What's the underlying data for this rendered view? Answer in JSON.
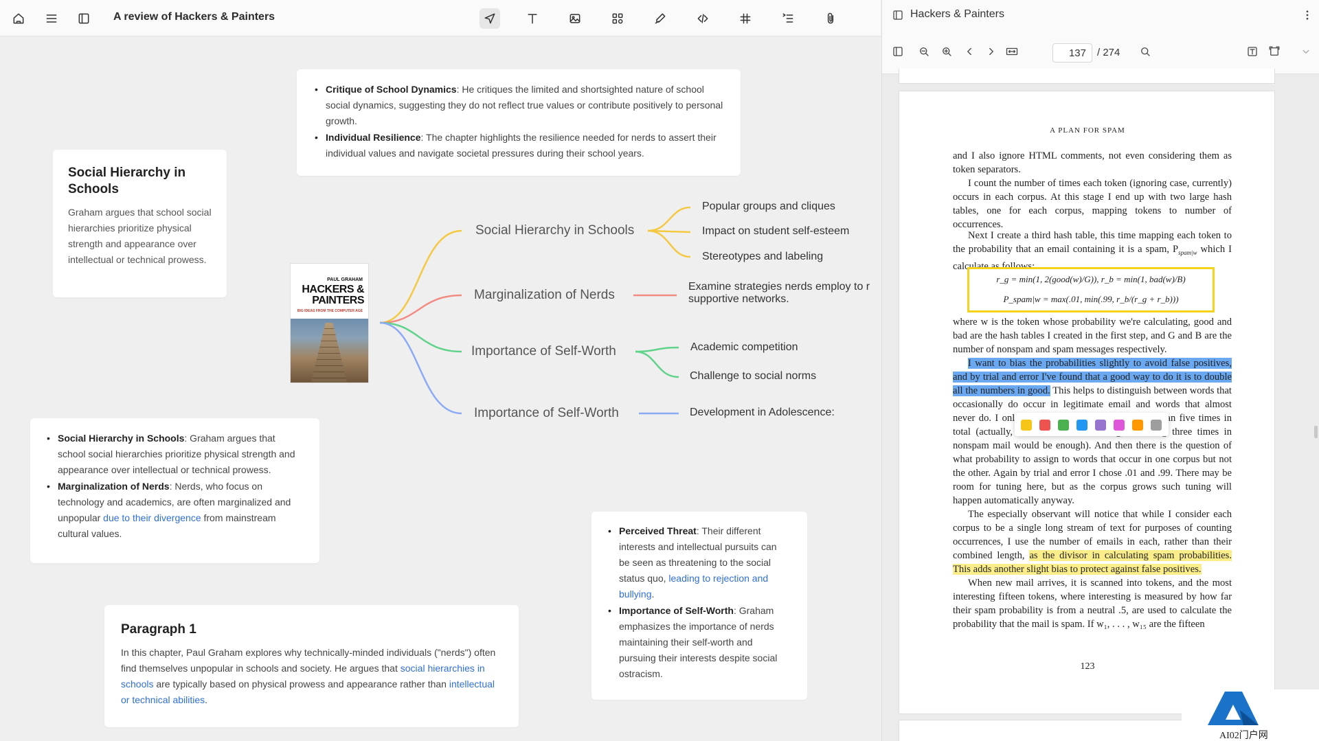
{
  "left": {
    "doc_title": "A review of Hackers & Painters",
    "toolbar_icons": [
      "home-icon",
      "menu-icon",
      "sidebar-icon",
      "navigate-icon",
      "text-icon",
      "image-icon",
      "shapes-icon",
      "pen-icon",
      "code-icon",
      "hash-icon",
      "outline-icon",
      "attach-icon"
    ],
    "top_card": {
      "items": [
        {
          "bold": "Critique of School Dynamics",
          "text": ": He critiques the limited and shortsighted nature of school social dynamics, suggesting they do not reflect true values or contribute positively to personal growth."
        },
        {
          "bold": "Individual Resilience",
          "text": ": The chapter highlights the resilience needed for nerds to assert their individual values and navigate societal pressures during their school years."
        }
      ]
    },
    "social_card": {
      "title": "Social Hierarchy in Schools",
      "body": "Graham argues that school social hierarchies prioritize physical strength and appearance over intellectual or technical prowess."
    },
    "book_cover": {
      "author": "PAUL GRAHAM",
      "title_line1": "HACKERS &",
      "title_line2": "PAINTERS",
      "subtitle": "BIG IDEAS FROM THE COMPUTER AGE"
    },
    "mindmap": {
      "branches": [
        {
          "label": "Social Hierarchy in Schools",
          "color": "#f5c842",
          "leaves": [
            "Popular groups and cliques",
            "Impact on student self-esteem",
            "Stereotypes and labeling"
          ]
        },
        {
          "label": "Marginalization of Nerds",
          "color": "#f28b82",
          "leaves": [
            "Examine strategies nerds employ to r",
            "supportive networks."
          ]
        },
        {
          "label": "Importance of Self-Worth",
          "color": "#5fd38a",
          "leaves": [
            "Academic competition",
            "Challenge to social norms"
          ]
        },
        {
          "label": "Importance of Self-Worth",
          "color": "#8aaaf5",
          "leaves": [
            "Development in Adolescence:"
          ]
        }
      ]
    },
    "bottom_left_card": {
      "items": [
        {
          "bold": "Social Hierarchy in Schools",
          "text": ": Graham argues that school social hierarchies prioritize physical strength and appearance over intellectual or technical prowess."
        },
        {
          "bold": "Marginalization of Nerds",
          "text": ": Nerds, who focus on technology and academics, are often marginalized and unpopular ",
          "link": "due to their divergence",
          "tail": " from mainstream cultural values."
        }
      ]
    },
    "paragraph_card": {
      "title": "Paragraph 1",
      "text1": "In this chapter, Paul Graham explores why technically-minded individuals (\"nerds\") often find themselves unpopular in schools and society. He argues that ",
      "link1": "social hierarchies in schools",
      "text2": " are typically based on physical prowess and appearance rather than ",
      "link2": "intellectual or technical abilities",
      "text3": "."
    },
    "right_card": {
      "items": [
        {
          "bold": "Perceived Threat",
          "text": ": Their different interests and intellectual pursuits can be seen as threatening to the social status quo, ",
          "link": "leading to rejection and bullying",
          "tail": "."
        },
        {
          "bold": "Importance of Self-Worth",
          "text": ": Graham emphasizes the importance of nerds maintaining their self-worth and pursuing their interests despite social ostracism."
        }
      ]
    }
  },
  "right": {
    "title": "Hackers & Painters",
    "current_page": "137",
    "total_pages": "/ 274",
    "pdf": {
      "running_head": "A PLAN FOR SPAM",
      "p1": "and I also ignore HTML comments, not even considering them as token separators.",
      "p2": "I count the number of times each token (ignoring case, currently) occurs in each corpus. At this stage I end up with two large hash tables, one for each corpus, mapping tokens to number of occurrences.",
      "p3": "Next I create a third hash table, this time mapping each token to the probability that an email containing it is a spam, P",
      "p3_sub": "spam|w",
      "p3_tail": " which I calculate as follows:",
      "formula1": "r_g = min(1, 2(good(w)/G)),   r_b = min(1, bad(w)/B)",
      "formula2": "P_spam|w = max(.01, min(.99, r_b/(r_g + r_b)))",
      "p4": "where w is the token whose probability we're calculating, good and bad are the hash tables I created in the first step, and G and B are the number of nonspam and spam messages respectively.",
      "p5_hl": "I want to bias the probabilities slightly to avoid false positives, and by trial and error I've found that a good way to do it is to double all the numbers in good.",
      "p5_rest": " This helps to distinguish between words that occasionally do occur in legitimate email and words that almost never do. I only consider words that occur more than five times in total (actually, because of the doubling, occurring three times in nonspam mail would be enough). And then there is the question of what probability to assign to words that occur in one corpus but not the other. Again by trial and error I chose .01 and .99. There may be room for tuning here, but as the corpus grows such tuning will happen automatically anyway.",
      "p6_pre": "The especially observant will notice that while I consider each corpus to be a single long stream of text for purposes of counting occurrences, I use the number of emails in each, rather than their combined length, ",
      "p6_hl": "as the divisor in calculating spam probabilities. This adds another slight bias to protect against false positives.",
      "p7": "When new mail arrives, it is scanned into tokens, and the most interesting fifteen tokens, where interesting is measured by how far their spam probability is from a neutral .5, are used to calculate the probability that the mail is spam. If w₁, . . . , w₁₅ are the fifteen",
      "page_number": "123"
    },
    "highlight_colors": [
      "#f5c518",
      "#ef5350",
      "#4caf50",
      "#2196f3",
      "#9575cd",
      "#e056d8",
      "#ff9800",
      "#9e9e9e"
    ],
    "watermark": "AI02门户网"
  }
}
